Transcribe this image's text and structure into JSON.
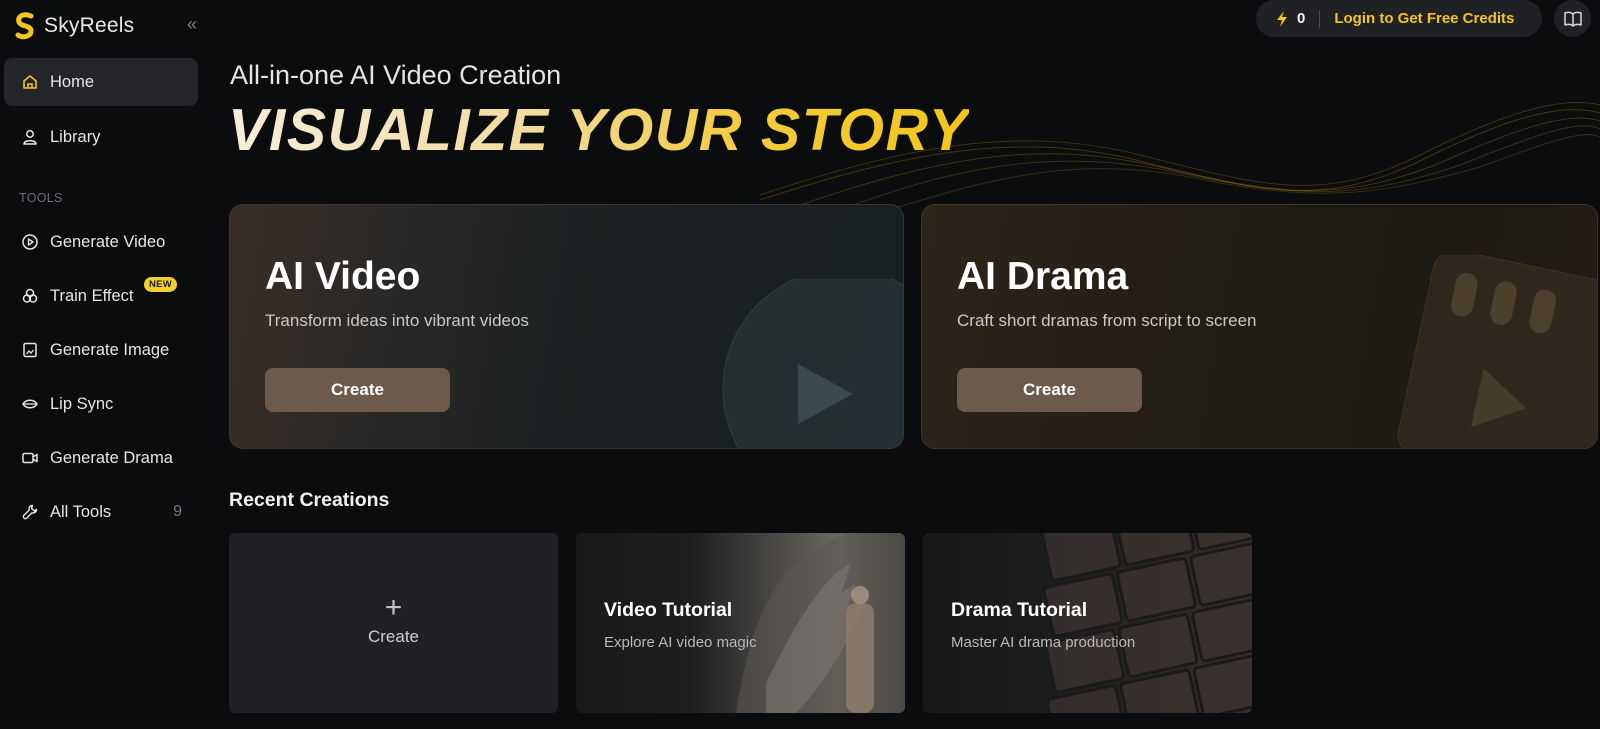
{
  "brand": {
    "name": "SkyReels"
  },
  "sidebar": {
    "collapse_icon": "double-chevron-left-icon",
    "main_items": [
      {
        "label": "Home",
        "icon": "home-icon",
        "active": true
      },
      {
        "label": "Library",
        "icon": "user-icon",
        "active": false
      }
    ],
    "section_label": "TOOLS",
    "tools": [
      {
        "label": "Generate Video",
        "icon": "play-circle-icon"
      },
      {
        "label": "Train Effect",
        "icon": "effect-icon",
        "badge": "NEW"
      },
      {
        "label": "Generate Image",
        "icon": "image-icon"
      },
      {
        "label": "Lip Sync",
        "icon": "lips-icon"
      },
      {
        "label": "Generate Drama",
        "icon": "video-camera-icon"
      },
      {
        "label": "All Tools",
        "icon": "wrench-icon",
        "count": "9"
      }
    ]
  },
  "topbar": {
    "credits": "0",
    "login_label": "Login to Get Free Credits",
    "accent": "#f3c523"
  },
  "hero": {
    "subtitle": "All-in-one AI Video Creation",
    "headline": "VISUALIZE YOUR STORY"
  },
  "cards": {
    "video": {
      "title": "AI Video",
      "desc": "Transform ideas into vibrant videos",
      "button": "Create"
    },
    "drama": {
      "title": "AI Drama",
      "desc": "Craft short dramas from script to screen",
      "button": "Create"
    }
  },
  "recent": {
    "title": "Recent Creations",
    "create_label": "Create",
    "tiles": [
      {
        "title": "Video Tutorial",
        "desc": "Explore AI video magic"
      },
      {
        "title": "Drama Tutorial",
        "desc": "Master AI drama production"
      }
    ]
  }
}
